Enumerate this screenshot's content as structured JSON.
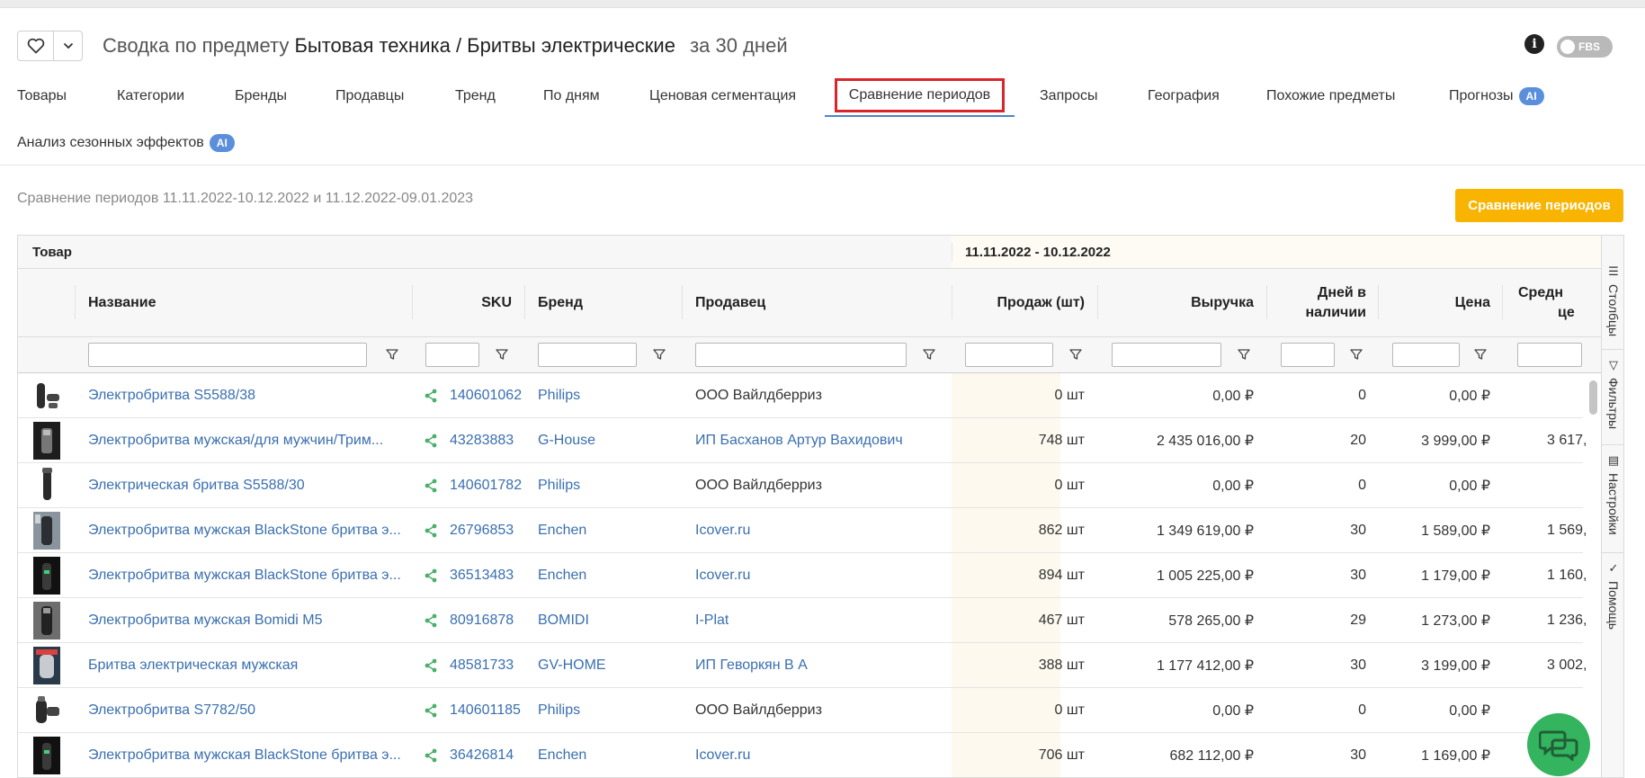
{
  "header": {
    "title_prefix": "Сводка по предмету",
    "subject": "Бытовая техника / Бритвы электрические",
    "period": "за 30 дней",
    "fbs_label": "FBS"
  },
  "tabs": [
    {
      "label": "Товары"
    },
    {
      "label": "Категории"
    },
    {
      "label": "Бренды"
    },
    {
      "label": "Продавцы"
    },
    {
      "label": "Тренд"
    },
    {
      "label": "По дням"
    },
    {
      "label": "Ценовая сегментация"
    },
    {
      "label": "Сравнение периодов"
    },
    {
      "label": "Запросы"
    },
    {
      "label": "География"
    },
    {
      "label": "Похожие предметы"
    },
    {
      "label": "Прогнозы",
      "badge": "AI"
    },
    {
      "label": "Анализ сезонных эффектов",
      "badge": "AI"
    }
  ],
  "subtitle": "Сравнение периодов 11.11.2022-10.12.2022 и 11.12.2022-09.01.2023",
  "compare_button": "Сравнение периодов",
  "grid": {
    "group_product": "Товар",
    "group_period": "11.11.2022 - 10.12.2022",
    "columns": {
      "name": "Название",
      "sku": "SKU",
      "brand": "Бренд",
      "seller": "Продавец",
      "sales": "Продаж (шт)",
      "revenue": "Выручка",
      "days_line1": "Дней в",
      "days_line2": "наличии",
      "price": "Цена",
      "avg_line1": "Средн",
      "avg_line2": "це"
    },
    "rows": [
      {
        "name": "Электробритва S5588/38",
        "sku": "140601062",
        "brand": "Philips",
        "seller": "ООО Вайлдберриз",
        "seller_link": false,
        "sales": "0 шт",
        "revenue": "0,00 ₽",
        "days": "0",
        "price": "0,00 ₽",
        "avg": ""
      },
      {
        "name": "Электробритва мужская/для мужчин/Трим...",
        "sku": "43283883",
        "brand": "G-House",
        "seller": "ИП Басханов Артур Вахидович",
        "seller_link": true,
        "sales": "748 шт",
        "revenue": "2 435 016,00 ₽",
        "days": "20",
        "price": "3 999,00 ₽",
        "avg": "3 617,"
      },
      {
        "name": "Электрическая бритва S5588/30",
        "sku": "140601782",
        "brand": "Philips",
        "seller": "ООО Вайлдберриз",
        "seller_link": false,
        "sales": "0 шт",
        "revenue": "0,00 ₽",
        "days": "0",
        "price": "0,00 ₽",
        "avg": ""
      },
      {
        "name": "Электробритва мужская BlackStone бритва э...",
        "sku": "26796853",
        "brand": "Enchen",
        "seller": "Icover.ru",
        "seller_link": true,
        "sales": "862 шт",
        "revenue": "1 349 619,00 ₽",
        "days": "30",
        "price": "1 589,00 ₽",
        "avg": "1 569,"
      },
      {
        "name": "Электробритва мужская BlackStone бритва э...",
        "sku": "36513483",
        "brand": "Enchen",
        "seller": "Icover.ru",
        "seller_link": true,
        "sales": "894 шт",
        "revenue": "1 005 225,00 ₽",
        "days": "30",
        "price": "1 179,00 ₽",
        "avg": "1 160,"
      },
      {
        "name": "Электробритва мужская Bomidi M5",
        "sku": "80916878",
        "brand": "BOMIDI",
        "seller": "I-Plat",
        "seller_link": true,
        "sales": "467 шт",
        "revenue": "578 265,00 ₽",
        "days": "29",
        "price": "1 273,00 ₽",
        "avg": "1 236,"
      },
      {
        "name": "Бритва электрическая мужская",
        "sku": "48581733",
        "brand": "GV-HOME",
        "seller": "ИП Геворкян В А",
        "seller_link": true,
        "sales": "388 шт",
        "revenue": "1 177 412,00 ₽",
        "days": "30",
        "price": "3 199,00 ₽",
        "avg": "3 002,"
      },
      {
        "name": "Электробритва S7782/50",
        "sku": "140601185",
        "brand": "Philips",
        "seller": "ООО Вайлдберриз",
        "seller_link": false,
        "sales": "0 шт",
        "revenue": "0,00 ₽",
        "days": "0",
        "price": "0,00 ₽",
        "avg": ""
      },
      {
        "name": "Электробритва мужская BlackStone бритва э...",
        "sku": "36426814",
        "brand": "Enchen",
        "seller": "Icover.ru",
        "seller_link": true,
        "sales": "706 шт",
        "revenue": "682 112,00 ₽",
        "days": "30",
        "price": "1 169,00 ₽",
        "avg": ""
      }
    ]
  },
  "side_panel": {
    "columns": "Столбцы",
    "filters": "Фильтры",
    "settings": "Настройки",
    "help": "Помощь"
  },
  "colors": {
    "accent_link": "#3a6fb0",
    "compare_button": "#f8b400",
    "active_tab_highlight": "#d9262c",
    "ai_badge": "#5b8fdc",
    "share_icon": "#4caf6a",
    "chat_button": "#34b45e"
  }
}
